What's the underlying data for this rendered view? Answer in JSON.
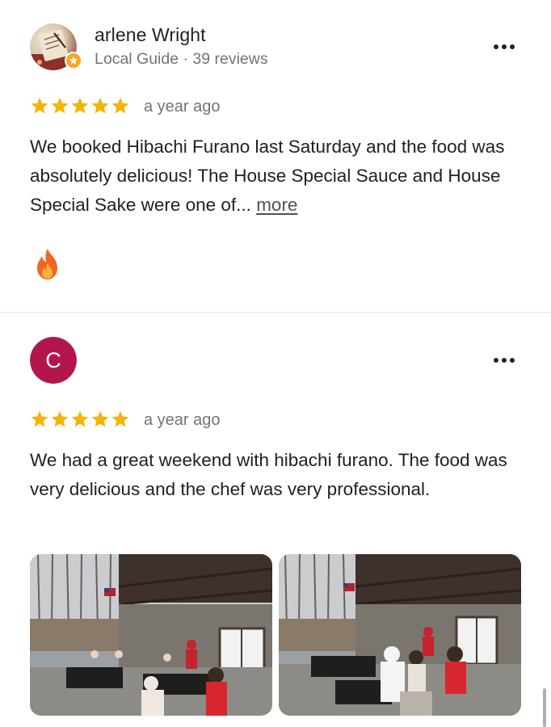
{
  "reviews": [
    {
      "author": {
        "name": "arlene Wright",
        "meta": "Local Guide · 39 reviews",
        "avatar": "photo-avatar",
        "badge": "local-guide-badge"
      },
      "rating": 5,
      "time": "a year ago",
      "text": "We booked Hibachi Furano last Saturday and the food was absolutely delicious! The House Special Sauce and House Special Sake were one of...",
      "more_label": "more",
      "reaction_icon": "fire-icon"
    },
    {
      "author": {
        "name": "",
        "initial": "C",
        "avatar_color": "#b3164d"
      },
      "rating": 5,
      "time": "a year ago",
      "text": "We had a great weekend with hibachi furano. The food was very delicious and the chef was very professional.",
      "photos": [
        {
          "icon": "outdoor-dining-photo"
        },
        {
          "icon": "outdoor-dining-photo"
        }
      ]
    }
  ],
  "colors": {
    "star": "#f5b400",
    "text": "#202124",
    "meta": "#70757a",
    "divider": "#e4e4e4"
  },
  "icons": {
    "menu": "more-vert-icon",
    "star": "star-icon"
  }
}
